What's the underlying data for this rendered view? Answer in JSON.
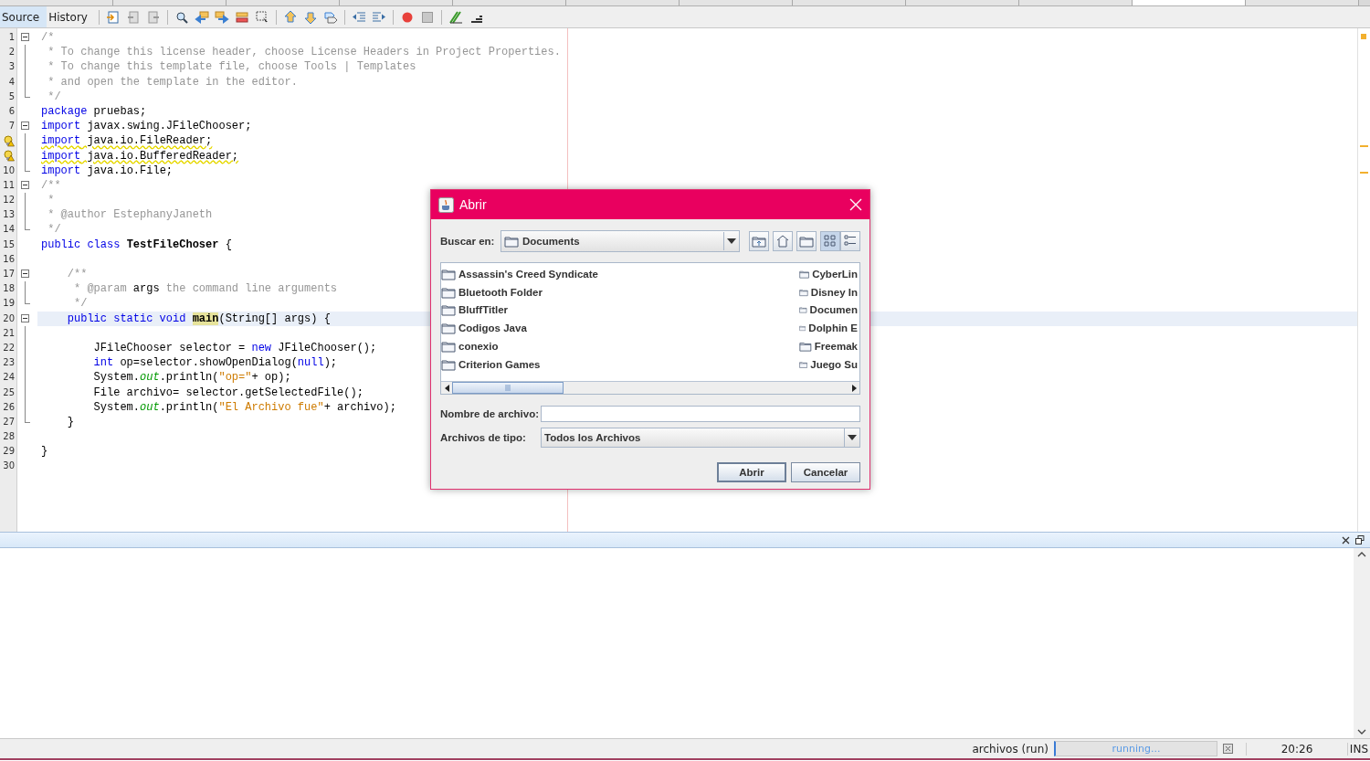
{
  "file_tabs": [
    {
      "selected": false
    },
    {
      "selected": false
    },
    {
      "selected": false
    },
    {
      "selected": false
    },
    {
      "selected": false
    },
    {
      "selected": false
    },
    {
      "selected": false
    },
    {
      "selected": false
    },
    {
      "selected": false
    },
    {
      "selected": false
    },
    {
      "selected": true
    },
    {
      "selected": false
    }
  ],
  "editor_tabs": [
    {
      "label": "Source",
      "selected": true
    },
    {
      "label": "History",
      "selected": false
    }
  ],
  "lines": [
    {
      "number": "1",
      "fold": {
        "kind": "start"
      },
      "tokens": [
        {
          "kind": "comment",
          "text": "/*"
        }
      ]
    },
    {
      "number": "2",
      "fold": {
        "kind": "line"
      },
      "tokens": [
        {
          "kind": "comment",
          "text": " * To change this license header, choose License Headers in Project Properties."
        }
      ]
    },
    {
      "number": "3",
      "fold": {
        "kind": "line"
      },
      "tokens": [
        {
          "kind": "comment",
          "text": " * To change this template file, choose Tools | Templates"
        }
      ]
    },
    {
      "number": "4",
      "fold": {
        "kind": "line"
      },
      "tokens": [
        {
          "kind": "comment",
          "text": " * and open the template in the editor."
        }
      ]
    },
    {
      "number": "5",
      "fold": {
        "kind": "end"
      },
      "tokens": [
        {
          "kind": "comment",
          "text": " */"
        }
      ]
    },
    {
      "number": "6",
      "tokens": [
        {
          "kind": "keyword",
          "text": "package"
        },
        {
          "kind": "plain",
          "text": " pruebas;"
        }
      ]
    },
    {
      "number": "7",
      "fold": {
        "kind": "start"
      },
      "tokens": [
        {
          "kind": "keyword",
          "text": "import"
        },
        {
          "kind": "plain",
          "text": " javax.swing.JFileChooser;"
        }
      ]
    },
    {
      "warning": true,
      "fold": {
        "kind": "line"
      },
      "tokens": [
        {
          "kind": "keyword",
          "text": "import"
        },
        {
          "kind": "plain",
          "text": " java.io.FileReader;"
        }
      ]
    },
    {
      "warning": true,
      "fold": {
        "kind": "line"
      },
      "tokens": [
        {
          "kind": "keyword",
          "text": "import"
        },
        {
          "kind": "plain",
          "text": " java.io.BufferedReader;"
        }
      ]
    },
    {
      "number": "10",
      "fold": {
        "kind": "end"
      },
      "tokens": [
        {
          "kind": "keyword",
          "text": "import"
        },
        {
          "kind": "plain",
          "text": " java.io.File;"
        }
      ]
    },
    {
      "number": "11",
      "fold": {
        "kind": "start"
      },
      "tokens": [
        {
          "kind": "comment",
          "text": "/**"
        }
      ]
    },
    {
      "number": "12",
      "fold": {
        "kind": "line"
      },
      "tokens": [
        {
          "kind": "comment",
          "text": " *"
        }
      ]
    },
    {
      "number": "13",
      "fold": {
        "kind": "line"
      },
      "tokens": [
        {
          "kind": "comment",
          "text": " * @author EstephanyJaneth"
        }
      ]
    },
    {
      "number": "14",
      "fold": {
        "kind": "end"
      },
      "tokens": [
        {
          "kind": "comment",
          "text": " */"
        }
      ]
    },
    {
      "number": "15",
      "tokens": [
        {
          "kind": "keyword",
          "text": "public class "
        },
        {
          "kind": "bold",
          "text": "TestFileChoser"
        },
        {
          "kind": "plain",
          "text": " {"
        }
      ]
    },
    {
      "number": "16"
    },
    {
      "number": "17",
      "fold": {
        "kind": "start"
      },
      "tokens": [
        {
          "kind": "comment",
          "text": "    /**"
        }
      ]
    },
    {
      "number": "18",
      "fold": {
        "kind": "line"
      },
      "tokens": [
        {
          "kind": "comment",
          "text": "     * @param "
        },
        {
          "kind": "plain",
          "text": "args"
        },
        {
          "kind": "comment",
          "text": " the command line arguments"
        }
      ]
    },
    {
      "number": "19",
      "fold": {
        "kind": "end"
      },
      "tokens": [
        {
          "kind": "comment",
          "text": "     */"
        }
      ]
    },
    {
      "number": "20",
      "fold": {
        "kind": "start"
      },
      "current": true,
      "tokens": [
        {
          "kind": "keyword",
          "text": "    public static void "
        },
        {
          "kind": "marked",
          "text": "main"
        },
        {
          "kind": "plain",
          "text": "(String[] args) {"
        }
      ]
    },
    {
      "number": "21",
      "fold": {
        "kind": "line"
      }
    },
    {
      "number": "22",
      "fold": {
        "kind": "line"
      },
      "tokens": [
        {
          "kind": "plain",
          "text": "        JFileChooser selector = "
        },
        {
          "kind": "keyword",
          "text": "new"
        },
        {
          "kind": "plain",
          "text": " JFileChooser();"
        }
      ]
    },
    {
      "number": "23",
      "fold": {
        "kind": "line"
      },
      "tokens": [
        {
          "kind": "keyword",
          "text": "        int"
        },
        {
          "kind": "plain",
          "text": " op=selector.showOpenDialog("
        },
        {
          "kind": "keyword",
          "text": "null"
        },
        {
          "kind": "plain",
          "text": ");"
        }
      ]
    },
    {
      "number": "24",
      "fold": {
        "kind": "line"
      },
      "tokens": [
        {
          "kind": "plain",
          "text": "        System."
        },
        {
          "kind": "field",
          "text": "out"
        },
        {
          "kind": "plain",
          "text": ".println("
        },
        {
          "kind": "string",
          "text": "\"op=\""
        },
        {
          "kind": "plain",
          "text": "+ op);"
        }
      ]
    },
    {
      "number": "25",
      "fold": {
        "kind": "line"
      },
      "tokens": [
        {
          "kind": "plain",
          "text": "        File archivo= selector.getSelectedFile();"
        }
      ]
    },
    {
      "number": "26",
      "fold": {
        "kind": "line"
      },
      "tokens": [
        {
          "kind": "plain",
          "text": "        System."
        },
        {
          "kind": "field",
          "text": "out"
        },
        {
          "kind": "plain",
          "text": ".println("
        },
        {
          "kind": "string",
          "text": "\"El Archivo fue\""
        },
        {
          "kind": "plain",
          "text": "+ archivo);"
        }
      ]
    },
    {
      "number": "27",
      "fold": {
        "kind": "end"
      },
      "tokens": [
        {
          "kind": "plain",
          "text": "    }"
        }
      ]
    },
    {
      "number": "28"
    },
    {
      "number": "29",
      "tokens": [
        {
          "kind": "plain",
          "text": "}"
        }
      ]
    },
    {
      "number": "30"
    }
  ],
  "dialog": {
    "title": "Abrir",
    "look_in_label": "Buscar en:",
    "look_in_value": "Documents",
    "view_buttons": [
      {
        "kind": "list",
        "selected": true
      },
      {
        "kind": "details",
        "selected": false
      }
    ],
    "files_column_1": [
      "Assassin's Creed Syndicate",
      "Bluetooth Folder",
      "BluffTitler",
      "Codigos Java",
      "conexio",
      "Criterion Games"
    ],
    "files_column_2": [
      "CyberLin",
      "Disney In",
      "Documen",
      "Dolphin E",
      "Freemak",
      "Juego Su"
    ],
    "file_name_label": "Nombre de archivo:",
    "file_type_label": "Archivos de tipo:",
    "file_type_value": "Todos los Archivos",
    "buttons": [
      "Abrir",
      "Cancelar"
    ]
  },
  "status_bar": {
    "task": "archivos (run)",
    "progress": "running...",
    "level": 1,
    "position": "20:26",
    "mode": "INS"
  }
}
